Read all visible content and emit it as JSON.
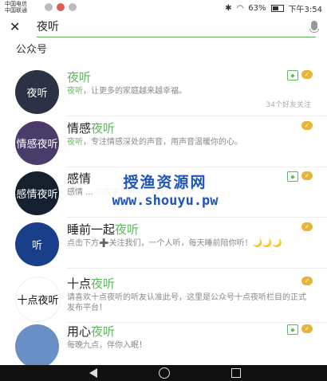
{
  "status": {
    "carrier1": "中国电信",
    "carrier2": "中国联通",
    "battery": "63%",
    "battery_level": 0.63,
    "time": "下午3:54"
  },
  "search": {
    "value": "夜听"
  },
  "section_title": "公众号",
  "items": [
    {
      "avatar_text": "夜听",
      "name_pre": "",
      "name_hl": "夜听",
      "name_post": "",
      "desc_hl": "夜听",
      "desc": "，让更多的家庭越来越幸福。",
      "meta": "34个好友关注",
      "verified": true,
      "avatar_color": "#2b3245"
    },
    {
      "avatar_text": "情感夜听",
      "name_pre": "情感",
      "name_hl": "夜听",
      "name_post": "",
      "desc_hl": "夜听",
      "desc": "，专注情感深处的声音，用声音温暖你的心。",
      "meta": "",
      "verified": false,
      "avatar_color": "#4a3c6a"
    },
    {
      "avatar_text": "感情夜听",
      "name_pre": "感情",
      "name_hl": "",
      "name_post": "",
      "desc_hl": "",
      "desc": "感情 ... 的故事。每晚八点，",
      "meta": "",
      "verified": true,
      "avatar_color": "#15202e"
    },
    {
      "avatar_text": "听",
      "name_pre": "睡前一起",
      "name_hl": "夜听",
      "name_post": "",
      "desc_hl": "",
      "desc": "点击下方➕关注我们，一个人听，每天睡前陪你听！🌙🌙🌙",
      "meta": "",
      "verified": false,
      "avatar_color": "#1a3f8a"
    },
    {
      "avatar_text": "十点夜听",
      "name_pre": "十点",
      "name_hl": "夜听",
      "name_post": "",
      "desc_hl": "",
      "desc": "请喜欢十点夜听的听友认准此号，这里是公众号十点夜听栏目的正式发布平台！",
      "meta": "",
      "verified": false,
      "avatar_color": "#ffffff"
    },
    {
      "avatar_text": "",
      "name_pre": "用心",
      "name_hl": "夜听",
      "name_post": "",
      "desc_hl": "",
      "desc": "每晚九点，伴你入眠！",
      "meta": "",
      "verified": true,
      "avatar_color": "#6a8fc4"
    }
  ],
  "watermark": {
    "line1": "授渔资源网",
    "line2": "www.shouyu.pw"
  },
  "icons": {
    "close": "close-icon",
    "mic": "microphone-icon",
    "verified": "verified-shield-icon",
    "check": "check-badge-icon"
  }
}
